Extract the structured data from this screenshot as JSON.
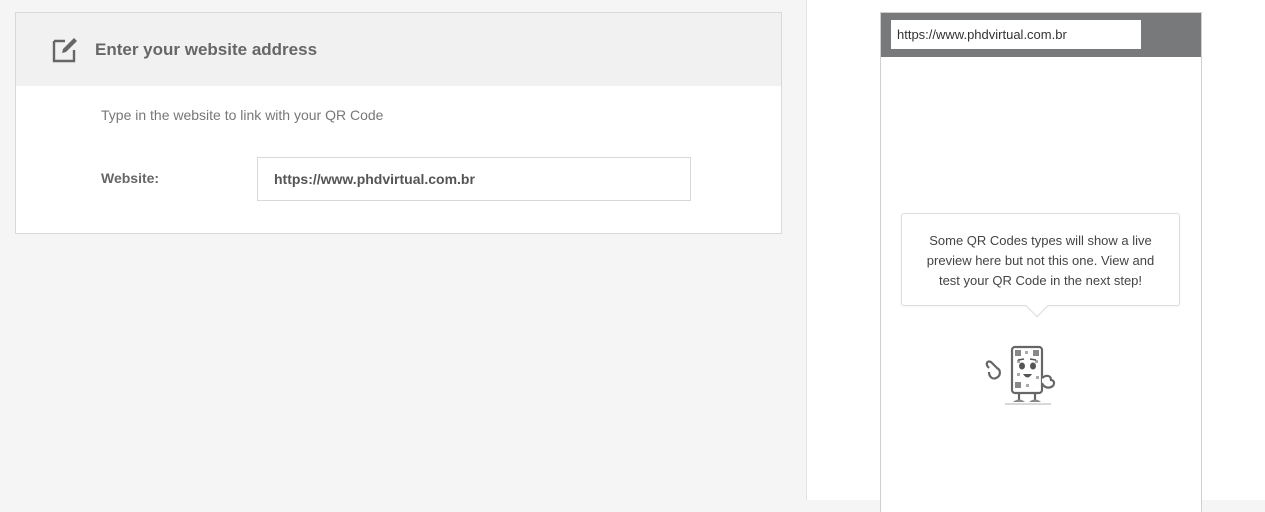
{
  "form": {
    "title": "Enter your website address",
    "title_icon": "edit-icon",
    "hint": "Type in the website to link with your QR Code",
    "website_label": "Website:",
    "website_value": "https://www.phdvirtual.com.br"
  },
  "preview": {
    "url_bar_value": "https://www.phdvirtual.com.br",
    "message": "Some QR Codes types will show a live preview here but not this one. View and test your QR Code in the next step!",
    "mascot_icon": "qr-mascot-icon"
  },
  "colors": {
    "header_bg": "#f1f1f1",
    "phone_bar": "#77797b",
    "page_bg": "#f5f5f5"
  }
}
